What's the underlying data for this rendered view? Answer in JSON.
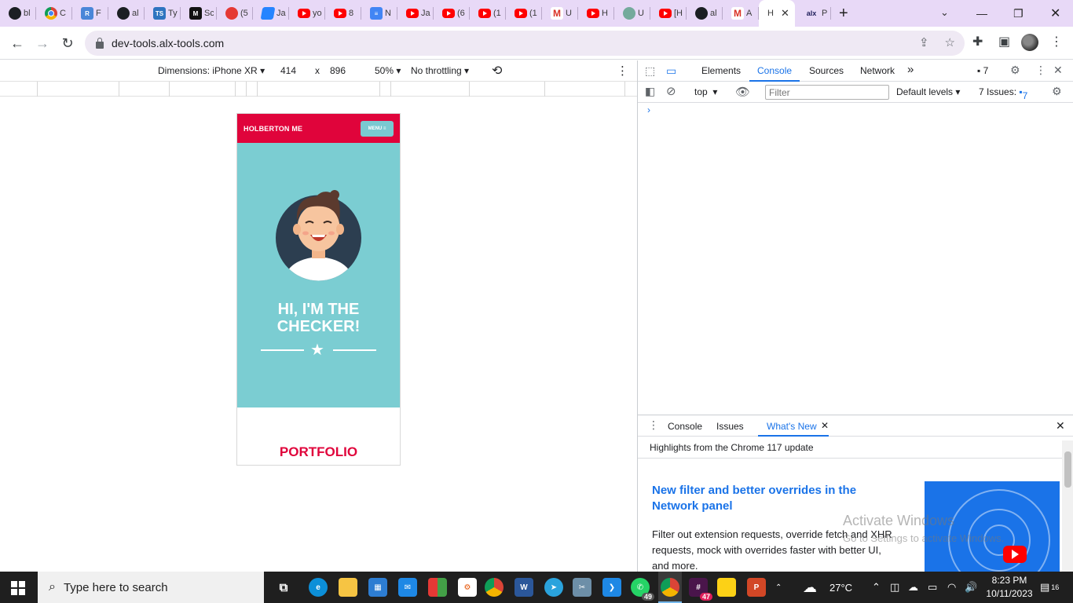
{
  "browser": {
    "tabs": [
      {
        "icon": "github-icon",
        "title": "bl"
      },
      {
        "icon": "chrome-icon",
        "title": "C"
      },
      {
        "icon": "r-icon",
        "title": "F"
      },
      {
        "icon": "github-icon",
        "title": "al"
      },
      {
        "icon": "ts-icon",
        "title": "Ty"
      },
      {
        "icon": "m-icon",
        "title": "Sc"
      },
      {
        "icon": "message-icon",
        "title": "(5"
      },
      {
        "icon": "jira-icon",
        "title": "Ja"
      },
      {
        "icon": "youtube-icon",
        "title": "yo"
      },
      {
        "icon": "youtube-icon",
        "title": "8"
      },
      {
        "icon": "docs-icon",
        "title": "N"
      },
      {
        "icon": "youtube-icon",
        "title": "Ja"
      },
      {
        "icon": "youtube-icon",
        "title": "(6"
      },
      {
        "icon": "youtube-icon",
        "title": "(1"
      },
      {
        "icon": "youtube-icon",
        "title": "(1"
      },
      {
        "icon": "gmail-icon",
        "title": "U"
      },
      {
        "icon": "youtube-icon",
        "title": "H"
      },
      {
        "icon": "chatgpt-icon",
        "title": "U"
      },
      {
        "icon": "youtube-icon",
        "title": "[H"
      },
      {
        "icon": "github-icon",
        "title": "al"
      },
      {
        "icon": "gmail-icon",
        "title": "A"
      }
    ],
    "active_tab": {
      "title": "H",
      "close": "✕"
    },
    "last_tab": {
      "logo": "alx",
      "title": "P"
    },
    "new_tab": "+",
    "url": "dev-tools.alx-tools.com"
  },
  "device_toolbar": {
    "dimensions": "Dimensions: iPhone XR",
    "width": "414",
    "times": "x",
    "height": "896",
    "zoom": "50%",
    "throttling": "No throttling"
  },
  "mobile_page": {
    "brand": "HOLBERTON ME",
    "menu_label": "MENU ≡",
    "hero_title": "HI, I'M THE CHECKER!",
    "section_title": "PORTFOLIO",
    "colors": {
      "primary": "#e0043b",
      "hero_bg": "#7bcdd2",
      "menu_bg": "#7ac9d1"
    }
  },
  "devtools": {
    "tabs": [
      "Elements",
      "Console",
      "Sources",
      "Network"
    ],
    "more_tabs": "»",
    "issues_badge": "7",
    "console": {
      "context": "top",
      "filter_placeholder": "Filter",
      "levels": "Default levels",
      "issues_label": "7 Issues:",
      "issues_count": "7",
      "prompt": "›"
    },
    "drawer": {
      "tabs": [
        "Console",
        "Issues",
        "What's New"
      ],
      "close_tab": "✕",
      "subtitle": "Highlights from the Chrome 117 update",
      "headline": "New filter and better overrides in the Network panel",
      "body": "Filter out extension requests, override fetch and XHR requests, mock with overrides faster with better UI, and more."
    },
    "watermark": {
      "line1": "Activate Windows",
      "line2": "Go to Settings to activate Windows."
    }
  },
  "taskbar": {
    "search_placeholder": "Type here to search",
    "whatsapp_badge": "49",
    "slack_badge": "47",
    "weather": "27°C",
    "time": "8:23 PM",
    "date": "10/11/2023",
    "notifications": "16"
  }
}
